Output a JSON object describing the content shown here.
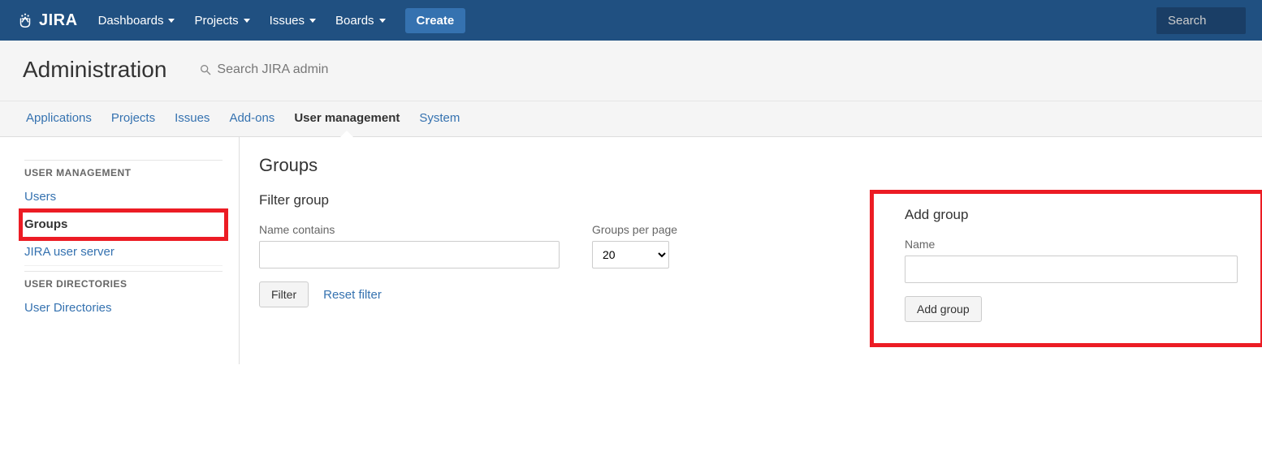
{
  "topnav": {
    "brand": "JIRA",
    "items": [
      "Dashboards",
      "Projects",
      "Issues",
      "Boards"
    ],
    "create": "Create",
    "search_placeholder": "Search"
  },
  "admin": {
    "title": "Administration",
    "search_placeholder": "Search JIRA admin",
    "tabs": [
      "Applications",
      "Projects",
      "Issues",
      "Add-ons",
      "User management",
      "System"
    ],
    "active_tab": "User management"
  },
  "sidebar": {
    "sections": [
      {
        "title": "USER MANAGEMENT",
        "items": [
          "Users",
          "Groups",
          "JIRA user server"
        ],
        "active": "Groups"
      },
      {
        "title": "USER DIRECTORIES",
        "items": [
          "User Directories"
        ]
      }
    ]
  },
  "page": {
    "heading": "Groups",
    "filter": {
      "title": "Filter group",
      "name_label": "Name contains",
      "name_value": "",
      "per_page_label": "Groups per page",
      "per_page_value": "20",
      "filter_btn": "Filter",
      "reset_link": "Reset filter"
    },
    "add": {
      "title": "Add group",
      "name_label": "Name",
      "name_value": "",
      "add_btn": "Add group"
    }
  }
}
